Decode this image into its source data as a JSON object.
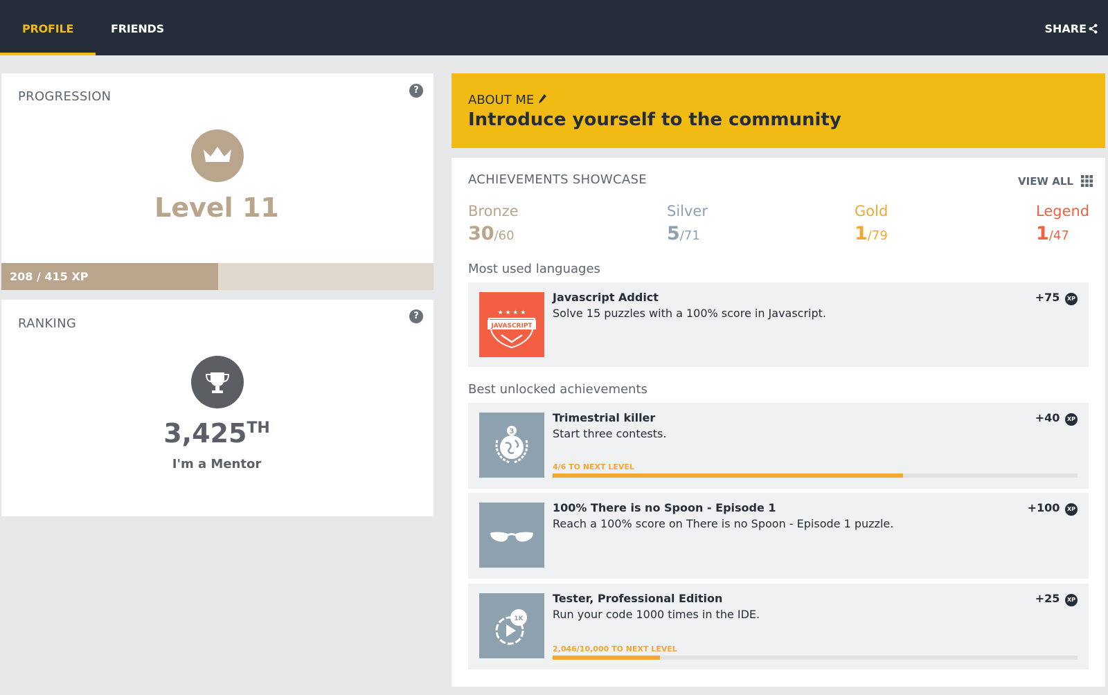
{
  "nav": {
    "tabs": [
      {
        "label": "PROFILE",
        "active": true
      },
      {
        "label": "FRIENDS",
        "active": false
      }
    ],
    "share_label": "SHARE"
  },
  "progression": {
    "title": "PROGRESSION",
    "help": "?",
    "level_label": "Level 11",
    "xp_label": "208 / 415 XP",
    "xp_current": 208,
    "xp_total": 415
  },
  "ranking": {
    "title": "RANKING",
    "help": "?",
    "rank": "3,425",
    "rank_suffix": "TH",
    "rank_title": "I'm a Mentor"
  },
  "about": {
    "title": "ABOUT ME",
    "subtitle": "Introduce yourself to the community"
  },
  "achievements": {
    "title": "ACHIEVEMENTS SHOWCASE",
    "view_all": "VIEW ALL",
    "tiers": [
      {
        "name": "Bronze",
        "count": "30",
        "total": "/60",
        "color": "#b8a58c"
      },
      {
        "name": "Silver",
        "count": "5",
        "total": "/71",
        "color": "#8ea1ae"
      },
      {
        "name": "Gold",
        "count": "1",
        "total": "/79",
        "color": "#f2a830"
      },
      {
        "name": "Legend",
        "count": "1",
        "total": "/47",
        "color": "#f35f43"
      }
    ],
    "languages_label": "Most used languages",
    "languages": [
      {
        "name": "Javascript Addict",
        "desc": "Solve 15 puzzles with a 100% score in Javascript.",
        "xp": "+75",
        "xp_badge": "XP",
        "icon": "javascript-badge-icon"
      }
    ],
    "best_label": "Best unlocked achievements",
    "best": [
      {
        "name": "Trimestrial killer",
        "desc": "Start three contests.",
        "xp": "+40",
        "xp_badge": "XP",
        "progress_label": "4/6 TO NEXT LEVEL",
        "progress": 0.667,
        "icon": "globe-laurel-icon"
      },
      {
        "name": "100% There is no Spoon - Episode 1",
        "desc": "Reach a 100% score on There is no Spoon - Episode 1 puzzle.",
        "xp": "+100",
        "xp_badge": "XP",
        "icon": "sunglasses-icon"
      },
      {
        "name": "Tester, Professional Edition",
        "desc": "Run your code 1000 times in the IDE.",
        "xp": "+25",
        "xp_badge": "XP",
        "progress_label": "2,046/10,000 TO NEXT LEVEL",
        "progress": 0.2046,
        "icon": "play-1k-icon",
        "icon_text": "1K"
      }
    ]
  },
  "colors": {
    "nav_bg": "#252e38",
    "accent": "#f2bb13",
    "bronze": "#b8a58c",
    "progress": "#f2a830"
  }
}
